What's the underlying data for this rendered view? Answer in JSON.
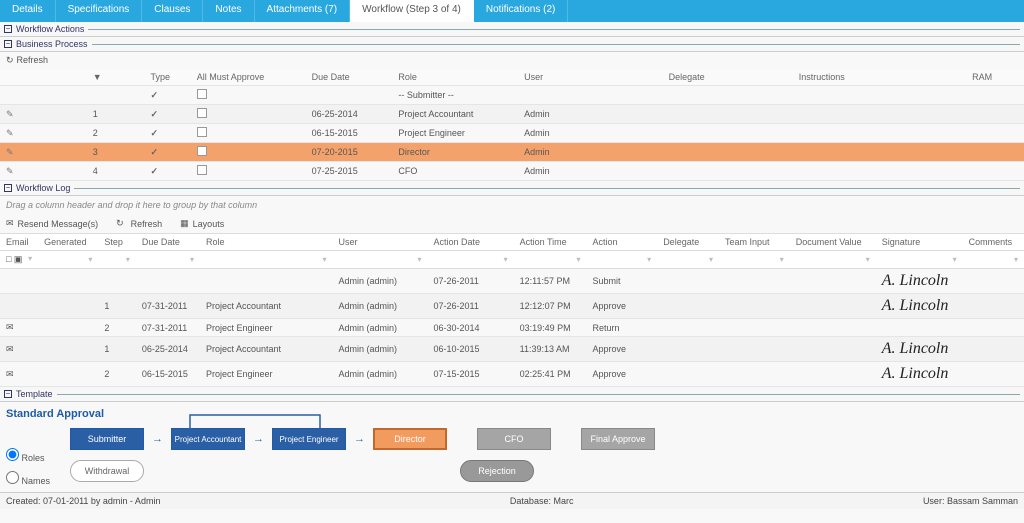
{
  "tabs": [
    "Details",
    "Specifications",
    "Clauses",
    "Notes",
    "Attachments (7)",
    "Workflow (Step 3 of 4)",
    "Notifications (2)"
  ],
  "active_tab_index": 5,
  "panels": {
    "workflow_actions": "Workflow Actions",
    "business_process": "Business Process",
    "workflow_log": "Workflow Log",
    "template": "Template"
  },
  "refresh_label": "Refresh",
  "actions": {
    "headers": {
      "star": "▼",
      "type": "Type",
      "must": "All Must Approve",
      "due": "Due Date",
      "role": "Role",
      "user": "User",
      "delegate": "Delegate",
      "instructions": "Instructions",
      "ram": "RAM"
    },
    "submitter_row_role": "-- Submitter --",
    "rows": [
      {
        "n": "1",
        "due": "06-25-2014",
        "role": "Project Accountant",
        "user": "Admin"
      },
      {
        "n": "2",
        "due": "06-15-2015",
        "role": "Project Engineer",
        "user": "Admin"
      },
      {
        "n": "3",
        "due": "07-20-2015",
        "role": "Director",
        "user": "Admin",
        "highlight": true
      },
      {
        "n": "4",
        "due": "07-25-2015",
        "role": "CFO",
        "user": "Admin"
      }
    ]
  },
  "drag_hint": "Drag a column header and drop it here to group by that column",
  "log_toolbar": {
    "resend": "Resend Message(s)",
    "refresh": "Refresh",
    "layouts": "Layouts"
  },
  "log": {
    "headers": {
      "email": "Email",
      "generated": "Generated",
      "step": "Step",
      "due": "Due Date",
      "role": "Role",
      "user": "User",
      "adate": "Action Date",
      "atime": "Action Time",
      "action": "Action",
      "delegate": "Delegate",
      "team": "Team Input",
      "doc": "Document Value",
      "sig": "Signature",
      "comments": "Comments"
    },
    "rows": [
      {
        "step": "",
        "due": "",
        "role": "",
        "user": "Admin (admin)",
        "adate": "07-26-2011",
        "atime": "12:11:57 PM",
        "action": "Submit",
        "sig": "A. Lincoln"
      },
      {
        "step": "1",
        "due": "07-31-2011",
        "role": "Project Accountant",
        "user": "Admin (admin)",
        "adate": "07-26-2011",
        "atime": "12:12:07 PM",
        "action": "Approve",
        "sig": "A. Lincoln"
      },
      {
        "step": "2",
        "due": "07-31-2011",
        "role": "Project Engineer",
        "user": "Admin (admin)",
        "adate": "06-30-2014",
        "atime": "03:19:49 PM",
        "action": "Return",
        "sig": ""
      },
      {
        "step": "1",
        "due": "06-25-2014",
        "role": "Project Accountant",
        "user": "Admin (admin)",
        "adate": "06-10-2015",
        "atime": "11:39:13 AM",
        "action": "Approve",
        "sig": "A. Lincoln"
      },
      {
        "step": "2",
        "due": "06-15-2015",
        "role": "Project Engineer",
        "user": "Admin (admin)",
        "adate": "07-15-2015",
        "atime": "02:25:41 PM",
        "action": "Approve",
        "sig": "A. Lincoln"
      }
    ]
  },
  "template": {
    "title": "Standard Approval",
    "radios": {
      "roles": "Roles",
      "names": "Names"
    },
    "nodes": {
      "submitter": "Submitter",
      "pa": "Project Accountant",
      "pe": "Project Engineer",
      "director": "Director",
      "cfo": "CFO",
      "final": "Final Approve",
      "withdrawal": "Withdrawal",
      "rejection": "Rejection"
    }
  },
  "footer": {
    "created_label": "Created:",
    "created_value": "07-01-2011 by admin - Admin",
    "db_label": "Database:",
    "db_value": "Marc",
    "user_label": "User:",
    "user_value": "Bassam Samman"
  }
}
